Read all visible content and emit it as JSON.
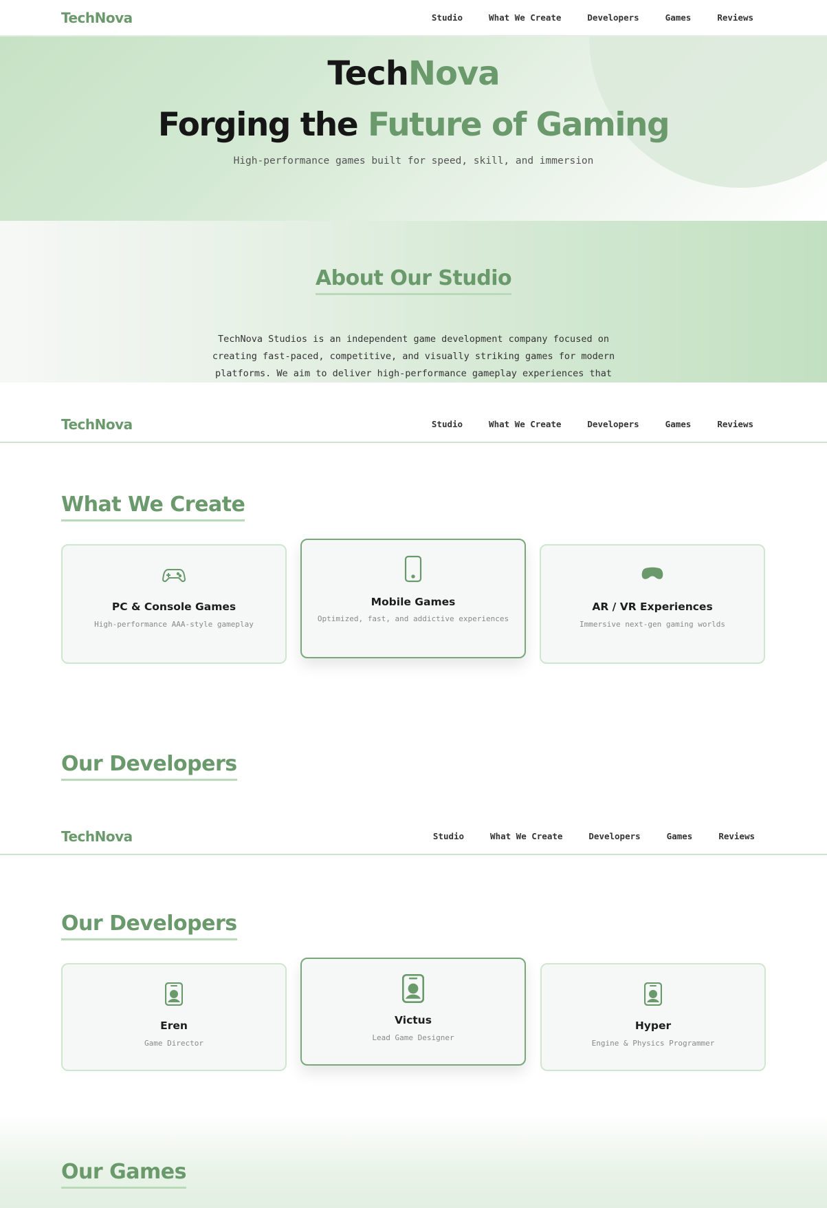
{
  "nav": {
    "logo": "TechNova",
    "links": [
      "Studio",
      "What We Create",
      "Developers",
      "Games",
      "Reviews"
    ]
  },
  "hero": {
    "brand_part1": "Tech",
    "brand_part2": "Nova",
    "headline_part1": "Forging the ",
    "headline_part2": "Future of Gaming",
    "subtitle": "High-performance games built for speed, skill, and immersion"
  },
  "about": {
    "title": "About Our Studio",
    "body": "TechNova Studios is an independent game development company focused on creating fast-paced, competitive, and visually striking games for modern platforms. We aim to deliver high-performance gameplay experiences that"
  },
  "create": {
    "title": "What We Create",
    "cards": [
      {
        "icon": "gamepad-icon",
        "title": "PC & Console Games",
        "desc": "High-performance AAA-style gameplay"
      },
      {
        "icon": "smartphone-icon",
        "title": "Mobile Games",
        "desc": "Optimized, fast, and addictive experiences"
      },
      {
        "icon": "vr-headset-icon",
        "title": "AR / VR Experiences",
        "desc": "Immersive next-gen gaming worlds"
      }
    ]
  },
  "developers": {
    "title": "Our Developers",
    "cards": [
      {
        "icon": "id-badge-icon",
        "name": "Eren",
        "role": "Game Director"
      },
      {
        "icon": "id-badge-icon",
        "name": "Victus",
        "role": "Lead Game Designer"
      },
      {
        "icon": "id-badge-icon",
        "name": "Hyper",
        "role": "Engine & Physics Programmer"
      }
    ]
  },
  "games": {
    "title": "Our Games"
  },
  "colors": {
    "accent": "#6a9a6c",
    "accent_light": "#cfe6cf",
    "text_dark": "#161616"
  }
}
